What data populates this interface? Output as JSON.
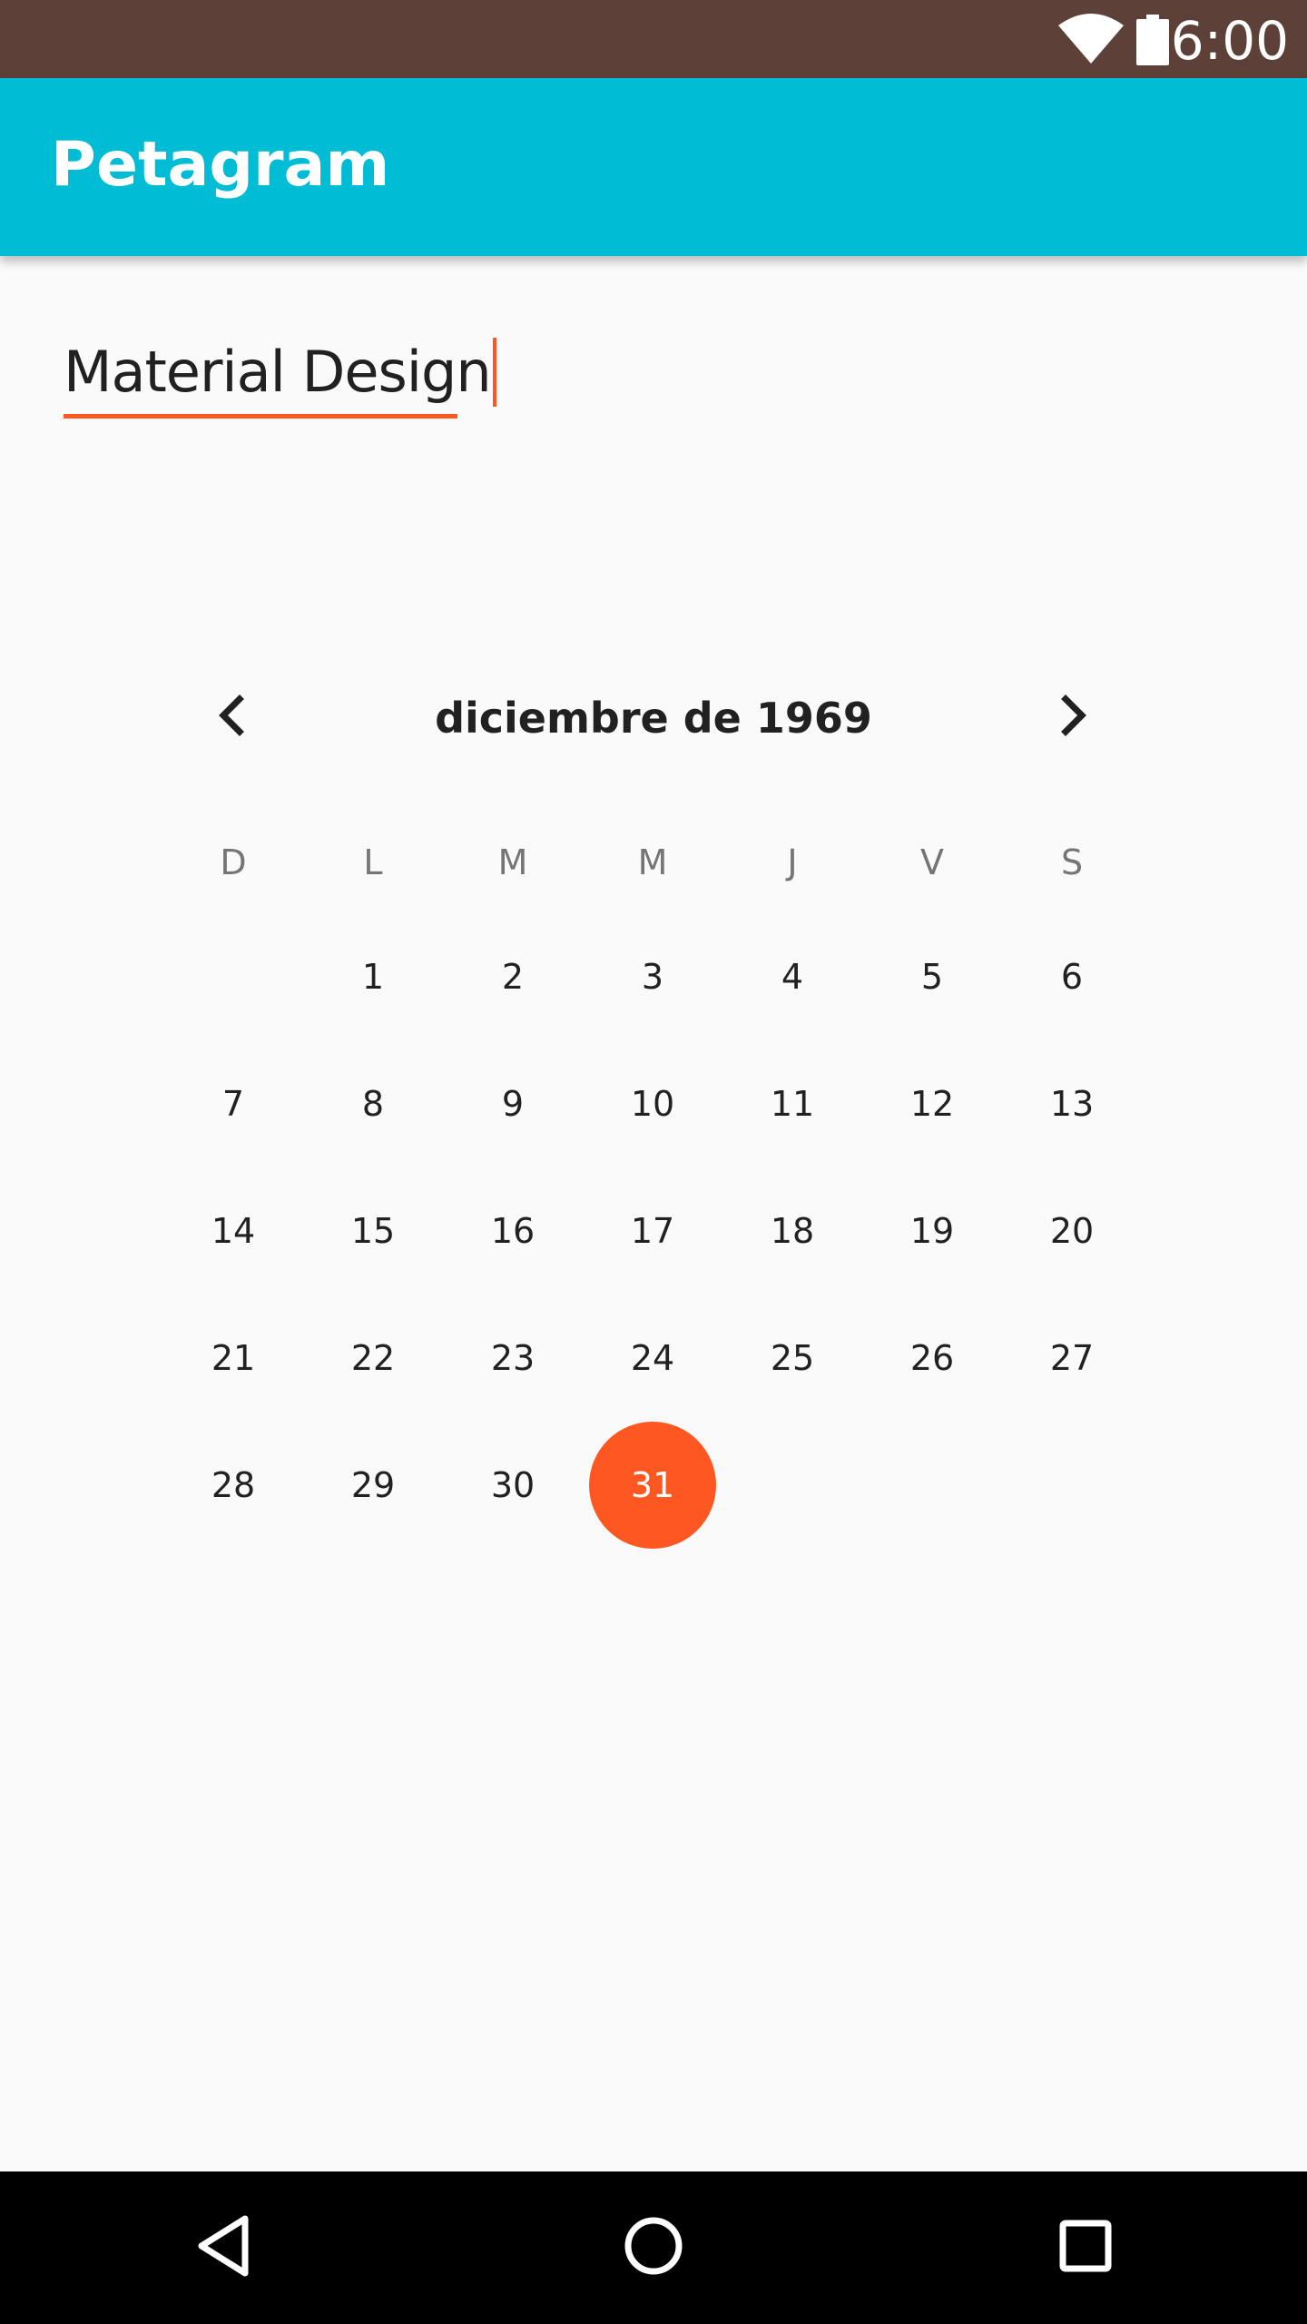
{
  "status_bar": {
    "time": "6:00",
    "icons": [
      "wifi-icon",
      "battery-icon"
    ],
    "background_color": "#5d4037"
  },
  "app_bar": {
    "title": "Petagram",
    "background_color": "#00bcd4"
  },
  "text_field": {
    "value": "Material Design",
    "accent_color": "#ff5722"
  },
  "calendar": {
    "month_label": "diciembre de 1969",
    "prev_icon": "chevron-left-icon",
    "next_icon": "chevron-right-icon",
    "weekdays": [
      "D",
      "L",
      "M",
      "M",
      "J",
      "V",
      "S"
    ],
    "first_weekday_index": 1,
    "days": [
      "1",
      "2",
      "3",
      "4",
      "5",
      "6",
      "7",
      "8",
      "9",
      "10",
      "11",
      "12",
      "13",
      "14",
      "15",
      "16",
      "17",
      "18",
      "19",
      "20",
      "21",
      "22",
      "23",
      "24",
      "25",
      "26",
      "27",
      "28",
      "29",
      "30",
      "31"
    ],
    "selected_day": "31",
    "selected_color": "#ff5722"
  },
  "nav_bar": {
    "icons": [
      "back-icon",
      "home-icon",
      "recents-icon"
    ]
  }
}
